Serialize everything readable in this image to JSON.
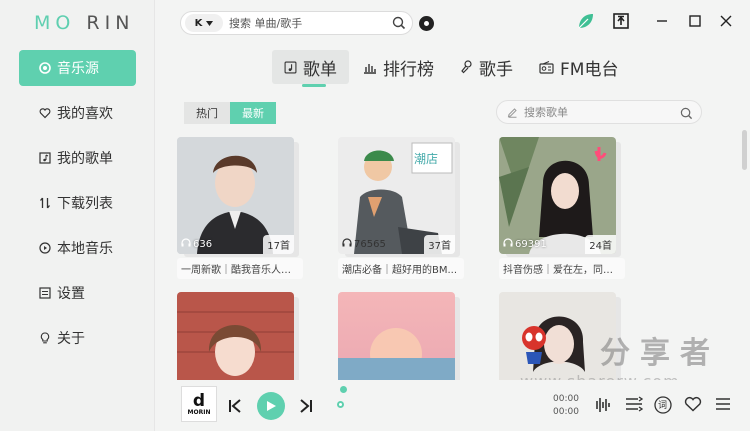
{
  "app": {
    "logo_a": "MO",
    "logo_b": "RIN"
  },
  "sidebar": {
    "items": [
      {
        "label": "音乐源",
        "icon": "music-source-icon",
        "active": true
      },
      {
        "label": "我的喜欢",
        "icon": "heart-icon",
        "active": false
      },
      {
        "label": "我的歌单",
        "icon": "playlist-icon",
        "active": false
      },
      {
        "label": "下载列表",
        "icon": "download-icon",
        "active": false
      },
      {
        "label": "本地音乐",
        "icon": "local-music-icon",
        "active": false
      },
      {
        "label": "设置",
        "icon": "settings-icon",
        "active": false
      },
      {
        "label": "关于",
        "icon": "bulb-icon",
        "active": false
      }
    ]
  },
  "topbar": {
    "source_label": "K",
    "search_placeholder": "搜索 单曲/歌手"
  },
  "tabs": [
    {
      "label": "歌单",
      "active": true
    },
    {
      "label": "排行榜",
      "active": false
    },
    {
      "label": "歌手",
      "active": false
    },
    {
      "label": "FM电台",
      "active": false
    }
  ],
  "filter": {
    "hot": "热门",
    "latest": "最新",
    "selected": "最新"
  },
  "list_search": {
    "placeholder": "搜索歌单"
  },
  "playlists": [
    {
      "plays": "636",
      "songs": "17首",
      "title": "一周新歌｜酷我音乐人热..."
    },
    {
      "plays": "76565",
      "songs": "37首",
      "title": "潮店必备｜超好用的BM..."
    },
    {
      "plays": "69391",
      "songs": "24首",
      "title": "抖音伤感｜爱在左，同情..."
    },
    {
      "plays": "",
      "songs": "",
      "title": ""
    },
    {
      "plays": "",
      "songs": "",
      "title": ""
    },
    {
      "plays": "",
      "songs": "",
      "title": ""
    }
  ],
  "player": {
    "album_letter": "d",
    "album_text": "MORIN",
    "current_time": "00:00",
    "total_time": "00:00",
    "lyric_label": "词"
  },
  "watermark": {
    "text": "分享者",
    "url": "www.sharerw.com"
  },
  "colors": {
    "accent": "#5fd0af",
    "background": "#f3f4f3"
  }
}
